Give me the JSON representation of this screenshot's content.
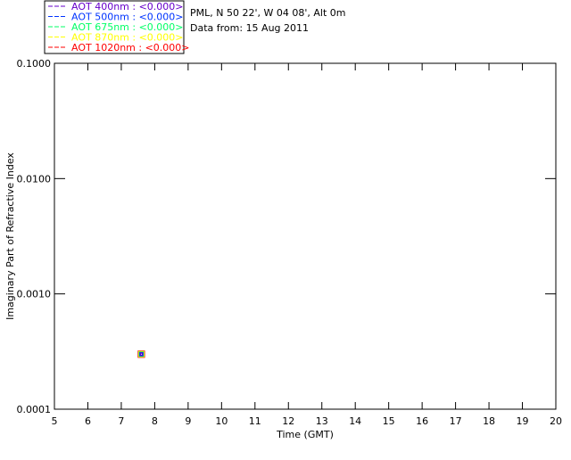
{
  "chart_data": {
    "type": "scatter",
    "header": [
      "PML, N 50 22', W 04 08', Alt 0m",
      "Data from: 15 Aug 2011"
    ],
    "legend": {
      "placement": "top-left",
      "entries": [
        {
          "label": "AOT  400nm : <0.000>",
          "color": "#6600cc"
        },
        {
          "label": "AOT  500nm : <0.000>",
          "color": "#0033ff"
        },
        {
          "label": "AOT  675nm : <0.000>",
          "color": "#00ff66"
        },
        {
          "label": "AOT  870nm : <0.000>",
          "color": "#ffff00"
        },
        {
          "label": "AOT 1020nm : <0.000>",
          "color": "#ff0000"
        }
      ]
    },
    "xlabel": "Time (GMT)",
    "ylabel": "Imaginary Part of Refractive Index",
    "xlim": [
      5,
      20
    ],
    "ylim": [
      0.0001,
      0.1
    ],
    "yscale": "log",
    "xticks": [
      "5",
      "6",
      "7",
      "8",
      "9",
      "10",
      "11",
      "12",
      "13",
      "14",
      "15",
      "16",
      "17",
      "18",
      "19",
      "20"
    ],
    "yticks": [
      {
        "value": 0.0001,
        "label": "0.0001"
      },
      {
        "value": 0.001,
        "label": "0.0010"
      },
      {
        "value": 0.01,
        "label": "0.0100"
      },
      {
        "value": 0.1,
        "label": "0.1000"
      }
    ],
    "grid": false,
    "series": [
      {
        "color": "#ff0000",
        "points": [
          [
            7.6,
            0.0003
          ]
        ]
      },
      {
        "color": "#ffff00",
        "points": [
          [
            7.6,
            0.0003
          ]
        ]
      },
      {
        "color": "#00ff66",
        "points": [
          [
            7.6,
            0.0003
          ]
        ]
      },
      {
        "color": "#0033ff",
        "points": [
          [
            7.6,
            0.0003
          ]
        ]
      },
      {
        "color": "#6600cc",
        "points": [
          [
            7.6,
            0.0003
          ]
        ]
      }
    ]
  }
}
